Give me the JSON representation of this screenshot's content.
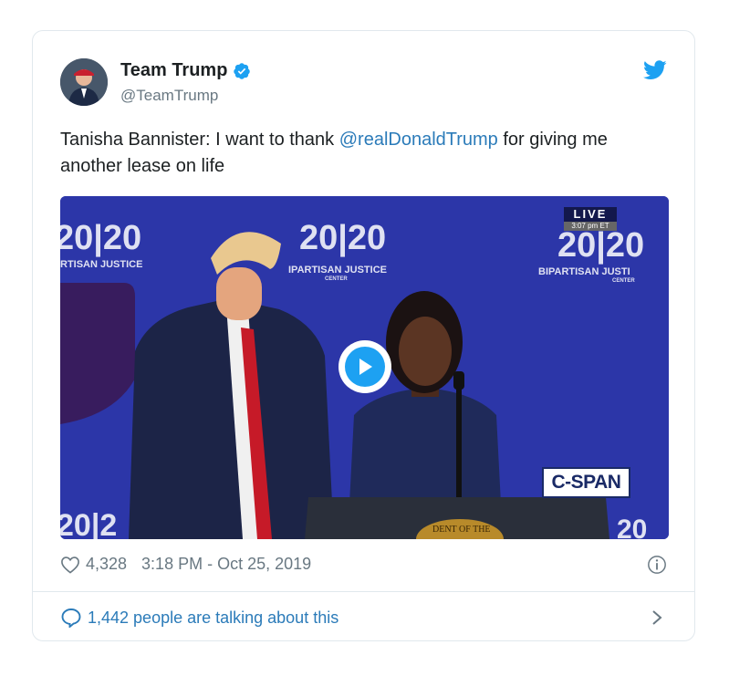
{
  "author": {
    "name": "Team Trump",
    "handle": "@TeamTrump",
    "verified": true
  },
  "tweet": {
    "text_prefix": "Tanisha Bannister: I want to thank ",
    "mention": "@realDonaldTrump",
    "text_suffix": " for giving me another lease on life"
  },
  "media": {
    "live_label": "LIVE",
    "live_time": "3:07 pm ET",
    "network": "C-SPAN",
    "backdrop_logo": "20|20",
    "backdrop_text": "BIPARTISAN JUSTICE",
    "backdrop_subtext": "CENTER",
    "podium_seal_text": "DENT OF THE",
    "play_icon": "play-icon"
  },
  "meta": {
    "likes": "4,328",
    "timestamp": "3:18 PM - Oct 25, 2019"
  },
  "footer": {
    "talking": "1,442 people are talking about this"
  },
  "colors": {
    "accent": "#1da1f2",
    "link": "#2b7bb9",
    "muted": "#697882",
    "backdrop": "#2c36a8"
  }
}
